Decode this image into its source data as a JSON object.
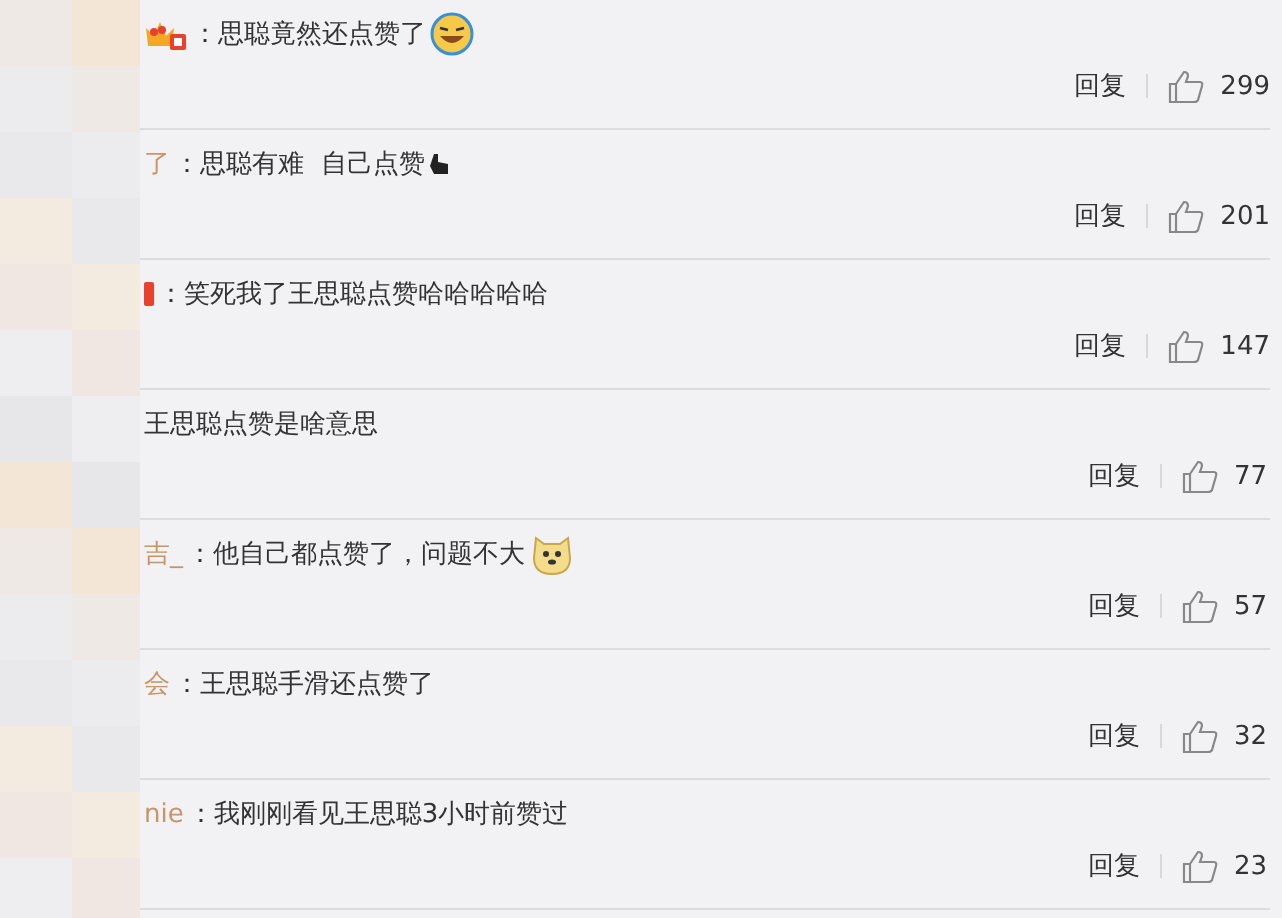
{
  "comments": [
    {
      "text": "：思聪竟然还点赞了",
      "reply": "回复",
      "likes": "299"
    },
    {
      "user": "了",
      "text": "：思聪有难  自己点赞",
      "reply": "回复",
      "likes": "201"
    },
    {
      "text": "：笑死我了王思聪点赞哈哈哈哈哈",
      "reply": "回复",
      "likes": "147"
    },
    {
      "text": "王思聪点赞是啥意思",
      "reply": "回复",
      "likes": "77"
    },
    {
      "user": "吉_",
      "text": "：他自己都点赞了，问题不大",
      "reply": "回复",
      "likes": "57"
    },
    {
      "user": "会",
      "text": "：王思聪手滑还点赞了",
      "reply": "回复",
      "likes": "32"
    },
    {
      "user": "nie",
      "text": "：我刚刚看见王思聪3小时前赞过",
      "reply": "回复",
      "likes": "23"
    }
  ]
}
